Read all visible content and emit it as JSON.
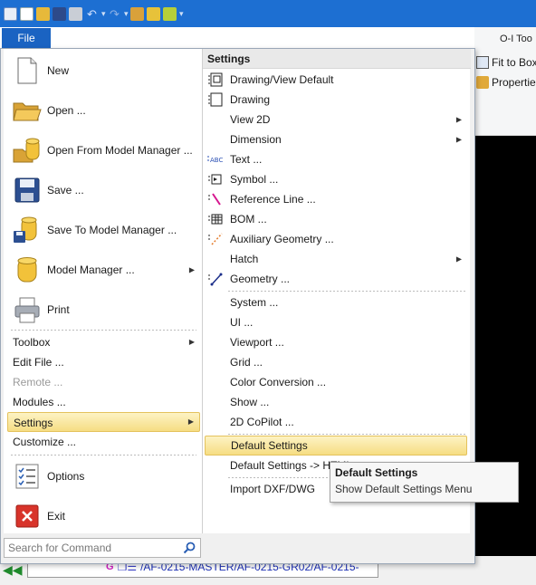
{
  "file_tab": {
    "label": "File"
  },
  "ribbon": {
    "tab_label": "O-I Too",
    "buttons": [
      {
        "label": "Fit to Box",
        "icon": "fit-to-box-icon"
      },
      {
        "label": "Properties",
        "icon": "properties-icon"
      }
    ]
  },
  "left_menu": {
    "big_items": [
      {
        "label": "New",
        "icon": "new-document-icon"
      },
      {
        "label": "Open ...",
        "icon": "open-folder-icon"
      },
      {
        "label": "Open From Model Manager ...",
        "icon": "open-model-manager-icon"
      },
      {
        "label": "Save ...",
        "icon": "save-icon"
      },
      {
        "label": "Save To Model Manager ...",
        "icon": "save-model-manager-icon"
      },
      {
        "label": "Model Manager ...",
        "icon": "model-manager-icon"
      },
      {
        "label": "Print",
        "icon": "print-icon"
      }
    ],
    "small_items": [
      {
        "label": "Toolbox",
        "has_submenu": true
      },
      {
        "label": "Edit File ..."
      },
      {
        "label": "Remote ...",
        "disabled": true
      },
      {
        "label": "Modules ..."
      },
      {
        "label": "Settings",
        "has_submenu": true,
        "selected": true
      },
      {
        "label": "Customize ..."
      }
    ],
    "bottom_items": [
      {
        "label": "Options",
        "icon": "options-checklist-icon"
      },
      {
        "label": "Exit",
        "icon": "exit-icon"
      }
    ]
  },
  "settings_menu": {
    "header": "Settings",
    "items": [
      {
        "label": "Drawing/View Default",
        "icon": "drawing-view-default-icon"
      },
      {
        "label": "Drawing",
        "icon": "drawing-icon"
      },
      {
        "label": "View 2D",
        "has_submenu": true
      },
      {
        "label": "Dimension",
        "has_submenu": true
      },
      {
        "label": "Text ...",
        "icon": "text-abc-icon"
      },
      {
        "label": "Symbol ...",
        "icon": "symbol-icon"
      },
      {
        "label": "Reference Line ...",
        "icon": "reference-line-icon"
      },
      {
        "label": "BOM ...",
        "icon": "bom-icon"
      },
      {
        "label": "Auxiliary Geometry ...",
        "icon": "auxiliary-geometry-icon"
      },
      {
        "label": "Hatch",
        "has_submenu": true
      },
      {
        "label": "Geometry ...",
        "icon": "geometry-icon"
      },
      {
        "label": "System ..."
      },
      {
        "label": "UI ..."
      },
      {
        "label": "Viewport ..."
      },
      {
        "label": "Grid ..."
      },
      {
        "label": "Color Conversion ..."
      },
      {
        "label": "Show ..."
      },
      {
        "label": "2D CoPilot ..."
      },
      {
        "label": "Default Settings",
        "highlighted": true
      },
      {
        "label": "Default Settings -> HTML"
      },
      {
        "label": "Import DXF/DWG"
      }
    ]
  },
  "search": {
    "placeholder": "Search for Command",
    "icon": "search-icon"
  },
  "tooltip": {
    "title": "Default Settings",
    "description": "Show Default Settings Menu"
  },
  "tree": {
    "type_letter": "G",
    "path": "/AF-0215-MASTER/AF-0215-GR02/AF-0215-"
  },
  "colors": {
    "title_bar": "#1d6fd2",
    "file_tab": "#1a63c2",
    "highlight": "#f6dd83",
    "tree_path": "#1b2fb5"
  }
}
